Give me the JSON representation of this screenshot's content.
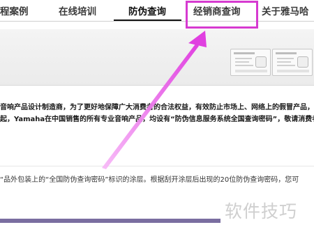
{
  "nav": {
    "items": [
      {
        "label": "程案例"
      },
      {
        "label": "在线培训"
      },
      {
        "label": "防伪查询"
      },
      {
        "label": "经销商查询"
      },
      {
        "label": "关于雅马哈"
      }
    ],
    "active_index": 2,
    "highlighted_index": 3
  },
  "content": {
    "line1": "音响产品设计制造商，为了更好地保障广大消费者的合法权益，有效防止市场上、网络上的假冒产品，",
    "line2": "起，Yamaha在中国销售的所有专业音响产品，均设有“防伪信息服务系统全国查询密码”，敬请消费者通",
    "line3": "“品外包装上的“全国防伪查询密码”标识的涂层。根据刮开涂层后出现的20位防伪查询密码，您可"
  },
  "watermark": "软件技巧",
  "colors": {
    "highlight": "#d63ad0",
    "arrow": "#e040e0",
    "bottom_bar": "#7a6ea0"
  },
  "icons": [
    "anti-counterfeit-card-image",
    "anti-counterfeit-card-image"
  ]
}
